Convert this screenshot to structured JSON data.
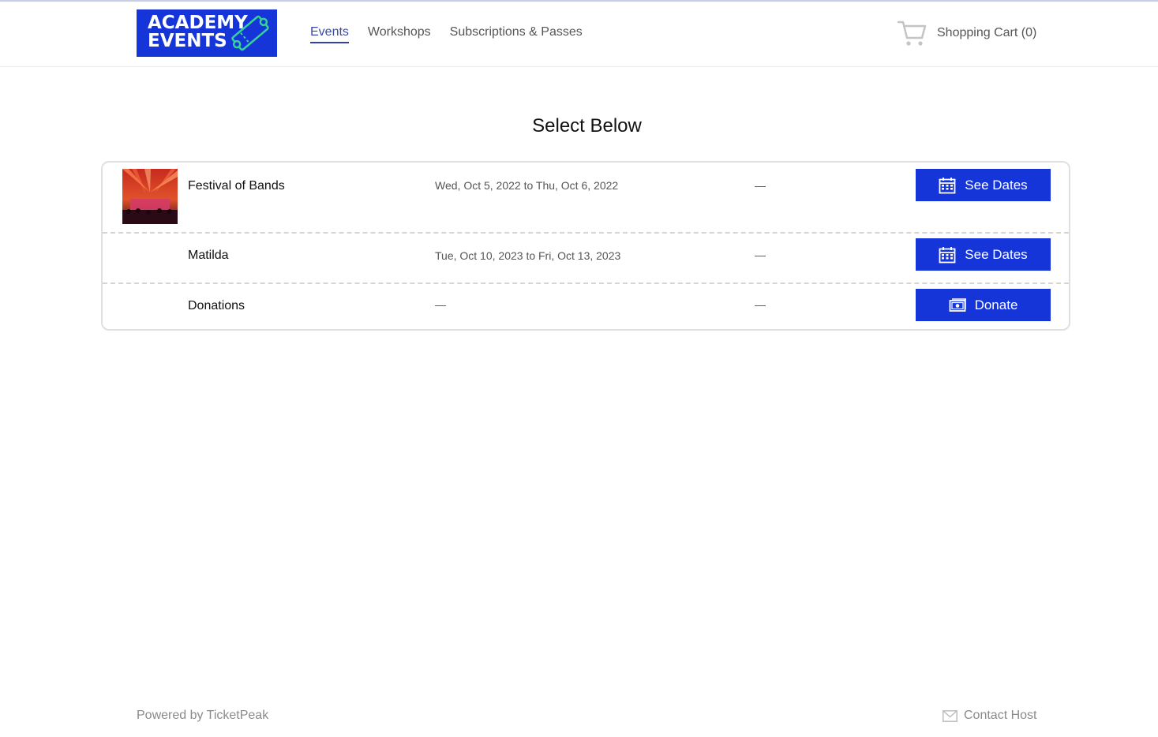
{
  "header": {
    "logo": {
      "line1": "ACADEMY",
      "line2": "EVENTS"
    },
    "nav": [
      {
        "label": "Events",
        "active": true
      },
      {
        "label": "Workshops",
        "active": false
      },
      {
        "label": "Subscriptions & Passes",
        "active": false
      }
    ],
    "cart": {
      "label": "Shopping Cart (0)",
      "icon": "shopping-cart-icon"
    }
  },
  "main": {
    "title": "Select Below",
    "items": [
      {
        "name": "Festival of Bands",
        "dates": "Wed, Oct 5, 2022 to Thu, Oct 6, 2022",
        "extra": "—",
        "action": {
          "label": "See Dates",
          "icon": "calendar-icon"
        },
        "has_thumbnail": true
      },
      {
        "name": "Matilda",
        "dates": "Tue, Oct 10, 2023 to Fri, Oct 13, 2023",
        "extra": "—",
        "action": {
          "label": "See Dates",
          "icon": "calendar-icon"
        },
        "has_thumbnail": false
      },
      {
        "name": "Donations",
        "dates": "—",
        "extra": "—",
        "action": {
          "label": "Donate",
          "icon": "money-icon"
        },
        "has_thumbnail": false
      }
    ]
  },
  "footer": {
    "powered_by": "Powered by TicketPeak",
    "contact": "Contact Host"
  },
  "colors": {
    "brand_blue": "#1535d8",
    "logo_green": "#34d399",
    "text_muted": "#8a8a8a",
    "border": "#e0e0e0"
  }
}
